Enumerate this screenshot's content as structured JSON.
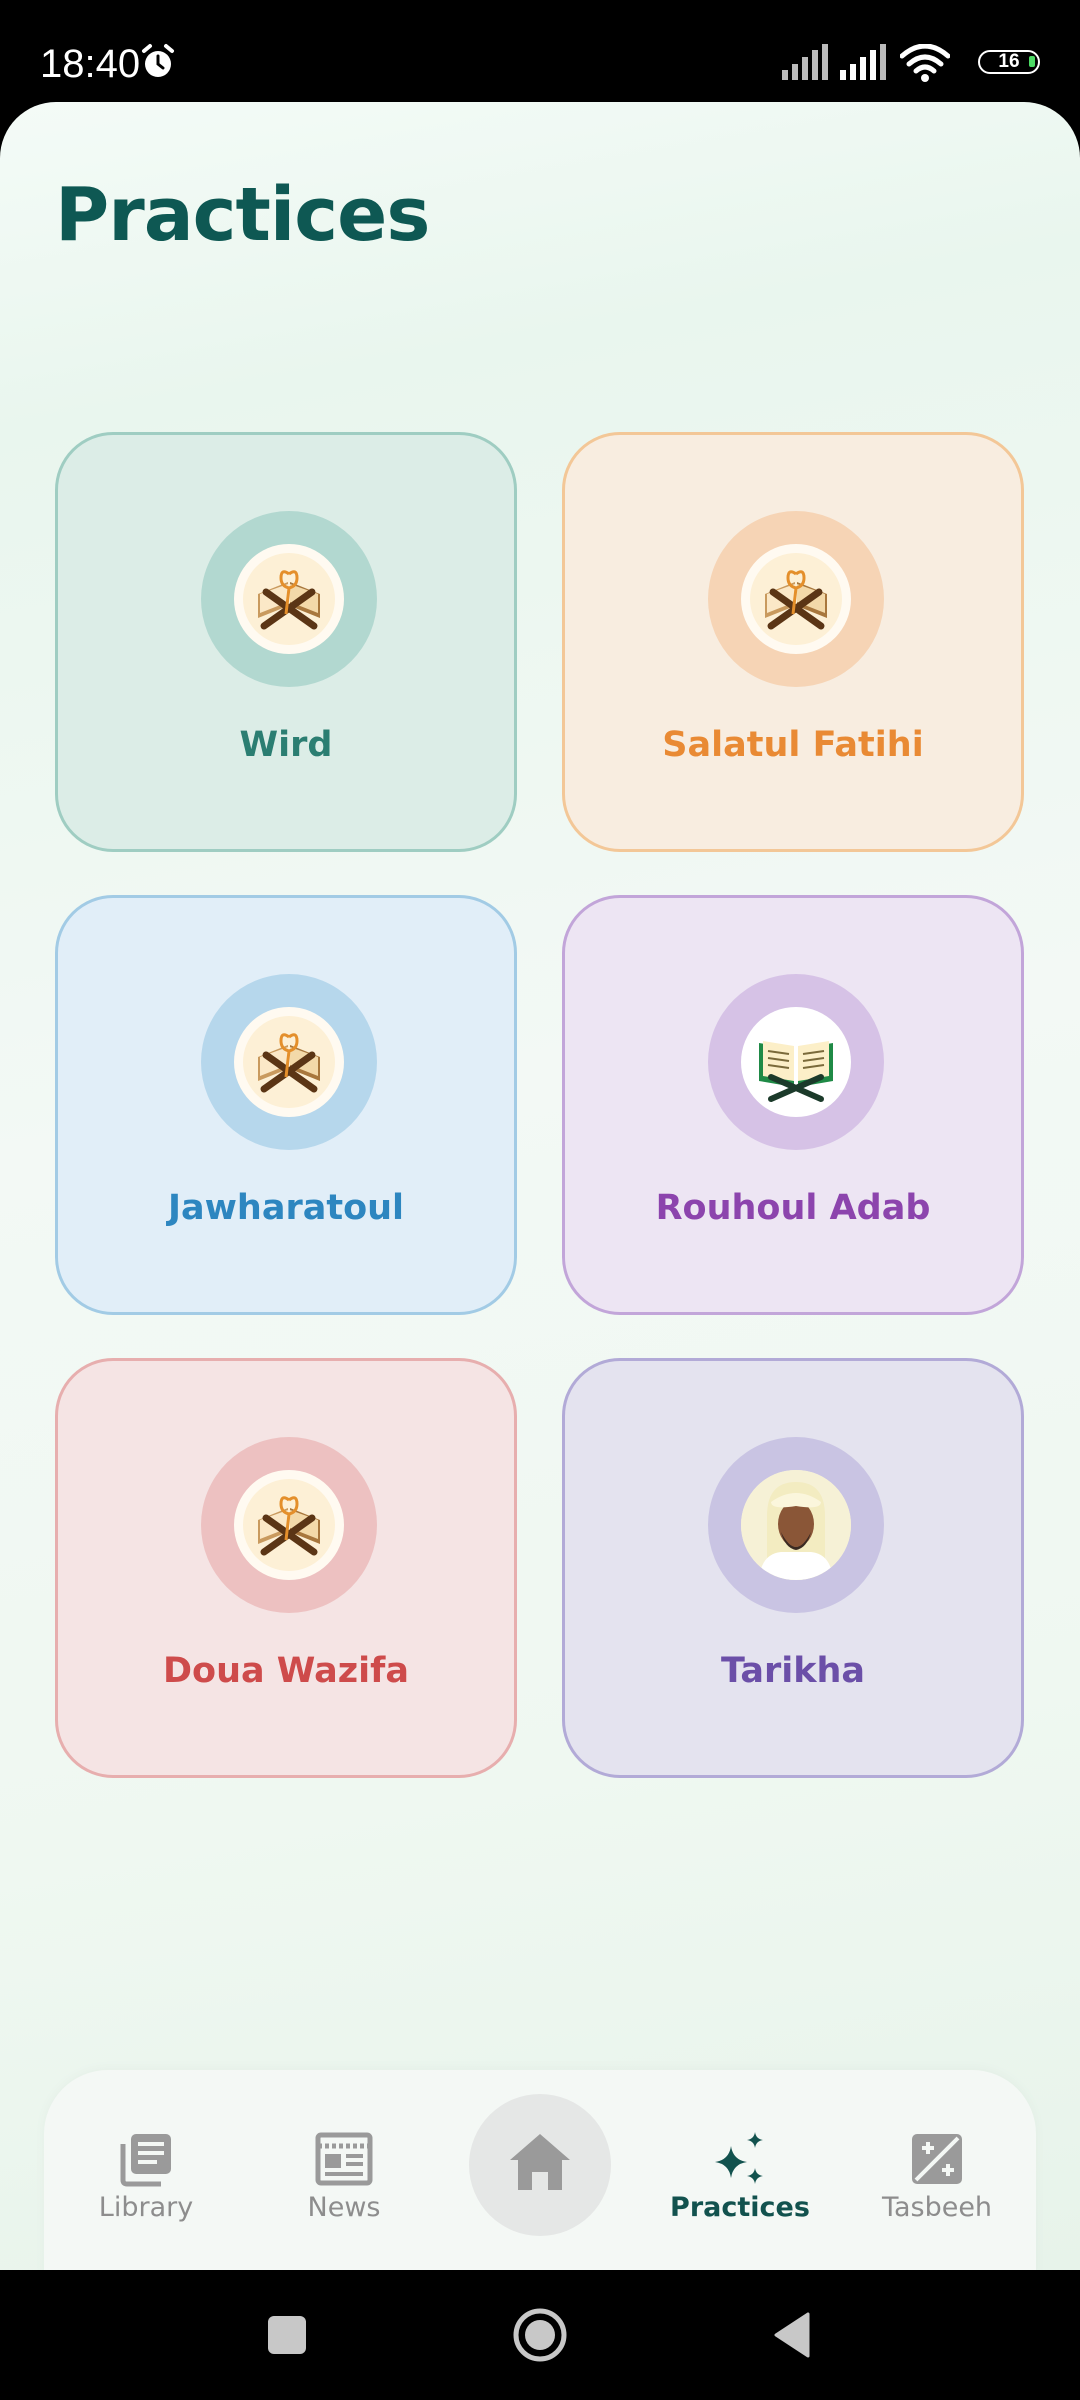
{
  "status_bar": {
    "time": "18:40",
    "battery_level": "16",
    "icons": [
      "alarm-icon",
      "signal-icon",
      "signal-icon",
      "wifi-icon",
      "battery-icon"
    ]
  },
  "page": {
    "title": "Practices"
  },
  "practices": [
    {
      "label": "Wird",
      "icon": "quran-stand-icon",
      "color": "#2b7e72"
    },
    {
      "label": "Salatul Fatihi",
      "icon": "quran-stand-icon",
      "color": "#e98a34"
    },
    {
      "label": "Jawharatoul",
      "icon": "quran-stand-icon",
      "color": "#2d86c0"
    },
    {
      "label": "Rouhoul Adab",
      "icon": "open-book-icon",
      "color": "#8c44ad"
    },
    {
      "label": "Doua Wazifa",
      "icon": "quran-stand-icon",
      "color": "#ce4b4b"
    },
    {
      "label": "Tarikha",
      "icon": "portrait-icon",
      "color": "#6b4fa8"
    }
  ],
  "bottom_nav": {
    "items": [
      {
        "label": "Library",
        "icon": "library-icon",
        "active": false
      },
      {
        "label": "News",
        "icon": "news-icon",
        "active": false
      },
      {
        "label": "",
        "icon": "home-icon",
        "active": false
      },
      {
        "label": "Practices",
        "icon": "sparkles-icon",
        "active": true
      },
      {
        "label": "Tasbeeh",
        "icon": "tasbeeh-counter-icon",
        "active": false
      }
    ],
    "active_color": "#12524e"
  }
}
